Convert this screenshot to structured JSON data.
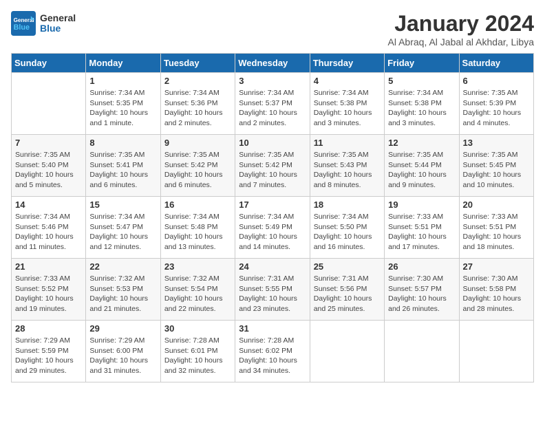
{
  "logo": {
    "text_general": "General",
    "text_blue": "Blue"
  },
  "calendar": {
    "title": "January 2024",
    "subtitle": "Al Abraq, Al Jabal al Akhdar, Libya",
    "days_of_week": [
      "Sunday",
      "Monday",
      "Tuesday",
      "Wednesday",
      "Thursday",
      "Friday",
      "Saturday"
    ],
    "weeks": [
      [
        {
          "day": "",
          "info": ""
        },
        {
          "day": "1",
          "info": "Sunrise: 7:34 AM\nSunset: 5:35 PM\nDaylight: 10 hours\nand 1 minute."
        },
        {
          "day": "2",
          "info": "Sunrise: 7:34 AM\nSunset: 5:36 PM\nDaylight: 10 hours\nand 2 minutes."
        },
        {
          "day": "3",
          "info": "Sunrise: 7:34 AM\nSunset: 5:37 PM\nDaylight: 10 hours\nand 2 minutes."
        },
        {
          "day": "4",
          "info": "Sunrise: 7:34 AM\nSunset: 5:38 PM\nDaylight: 10 hours\nand 3 minutes."
        },
        {
          "day": "5",
          "info": "Sunrise: 7:34 AM\nSunset: 5:38 PM\nDaylight: 10 hours\nand 3 minutes."
        },
        {
          "day": "6",
          "info": "Sunrise: 7:35 AM\nSunset: 5:39 PM\nDaylight: 10 hours\nand 4 minutes."
        }
      ],
      [
        {
          "day": "7",
          "info": "Sunrise: 7:35 AM\nSunset: 5:40 PM\nDaylight: 10 hours\nand 5 minutes."
        },
        {
          "day": "8",
          "info": "Sunrise: 7:35 AM\nSunset: 5:41 PM\nDaylight: 10 hours\nand 6 minutes."
        },
        {
          "day": "9",
          "info": "Sunrise: 7:35 AM\nSunset: 5:42 PM\nDaylight: 10 hours\nand 6 minutes."
        },
        {
          "day": "10",
          "info": "Sunrise: 7:35 AM\nSunset: 5:42 PM\nDaylight: 10 hours\nand 7 minutes."
        },
        {
          "day": "11",
          "info": "Sunrise: 7:35 AM\nSunset: 5:43 PM\nDaylight: 10 hours\nand 8 minutes."
        },
        {
          "day": "12",
          "info": "Sunrise: 7:35 AM\nSunset: 5:44 PM\nDaylight: 10 hours\nand 9 minutes."
        },
        {
          "day": "13",
          "info": "Sunrise: 7:35 AM\nSunset: 5:45 PM\nDaylight: 10 hours\nand 10 minutes."
        }
      ],
      [
        {
          "day": "14",
          "info": "Sunrise: 7:34 AM\nSunset: 5:46 PM\nDaylight: 10 hours\nand 11 minutes."
        },
        {
          "day": "15",
          "info": "Sunrise: 7:34 AM\nSunset: 5:47 PM\nDaylight: 10 hours\nand 12 minutes."
        },
        {
          "day": "16",
          "info": "Sunrise: 7:34 AM\nSunset: 5:48 PM\nDaylight: 10 hours\nand 13 minutes."
        },
        {
          "day": "17",
          "info": "Sunrise: 7:34 AM\nSunset: 5:49 PM\nDaylight: 10 hours\nand 14 minutes."
        },
        {
          "day": "18",
          "info": "Sunrise: 7:34 AM\nSunset: 5:50 PM\nDaylight: 10 hours\nand 16 minutes."
        },
        {
          "day": "19",
          "info": "Sunrise: 7:33 AM\nSunset: 5:51 PM\nDaylight: 10 hours\nand 17 minutes."
        },
        {
          "day": "20",
          "info": "Sunrise: 7:33 AM\nSunset: 5:51 PM\nDaylight: 10 hours\nand 18 minutes."
        }
      ],
      [
        {
          "day": "21",
          "info": "Sunrise: 7:33 AM\nSunset: 5:52 PM\nDaylight: 10 hours\nand 19 minutes."
        },
        {
          "day": "22",
          "info": "Sunrise: 7:32 AM\nSunset: 5:53 PM\nDaylight: 10 hours\nand 21 minutes."
        },
        {
          "day": "23",
          "info": "Sunrise: 7:32 AM\nSunset: 5:54 PM\nDaylight: 10 hours\nand 22 minutes."
        },
        {
          "day": "24",
          "info": "Sunrise: 7:31 AM\nSunset: 5:55 PM\nDaylight: 10 hours\nand 23 minutes."
        },
        {
          "day": "25",
          "info": "Sunrise: 7:31 AM\nSunset: 5:56 PM\nDaylight: 10 hours\nand 25 minutes."
        },
        {
          "day": "26",
          "info": "Sunrise: 7:30 AM\nSunset: 5:57 PM\nDaylight: 10 hours\nand 26 minutes."
        },
        {
          "day": "27",
          "info": "Sunrise: 7:30 AM\nSunset: 5:58 PM\nDaylight: 10 hours\nand 28 minutes."
        }
      ],
      [
        {
          "day": "28",
          "info": "Sunrise: 7:29 AM\nSunset: 5:59 PM\nDaylight: 10 hours\nand 29 minutes."
        },
        {
          "day": "29",
          "info": "Sunrise: 7:29 AM\nSunset: 6:00 PM\nDaylight: 10 hours\nand 31 minutes."
        },
        {
          "day": "30",
          "info": "Sunrise: 7:28 AM\nSunset: 6:01 PM\nDaylight: 10 hours\nand 32 minutes."
        },
        {
          "day": "31",
          "info": "Sunrise: 7:28 AM\nSunset: 6:02 PM\nDaylight: 10 hours\nand 34 minutes."
        },
        {
          "day": "",
          "info": ""
        },
        {
          "day": "",
          "info": ""
        },
        {
          "day": "",
          "info": ""
        }
      ]
    ]
  }
}
